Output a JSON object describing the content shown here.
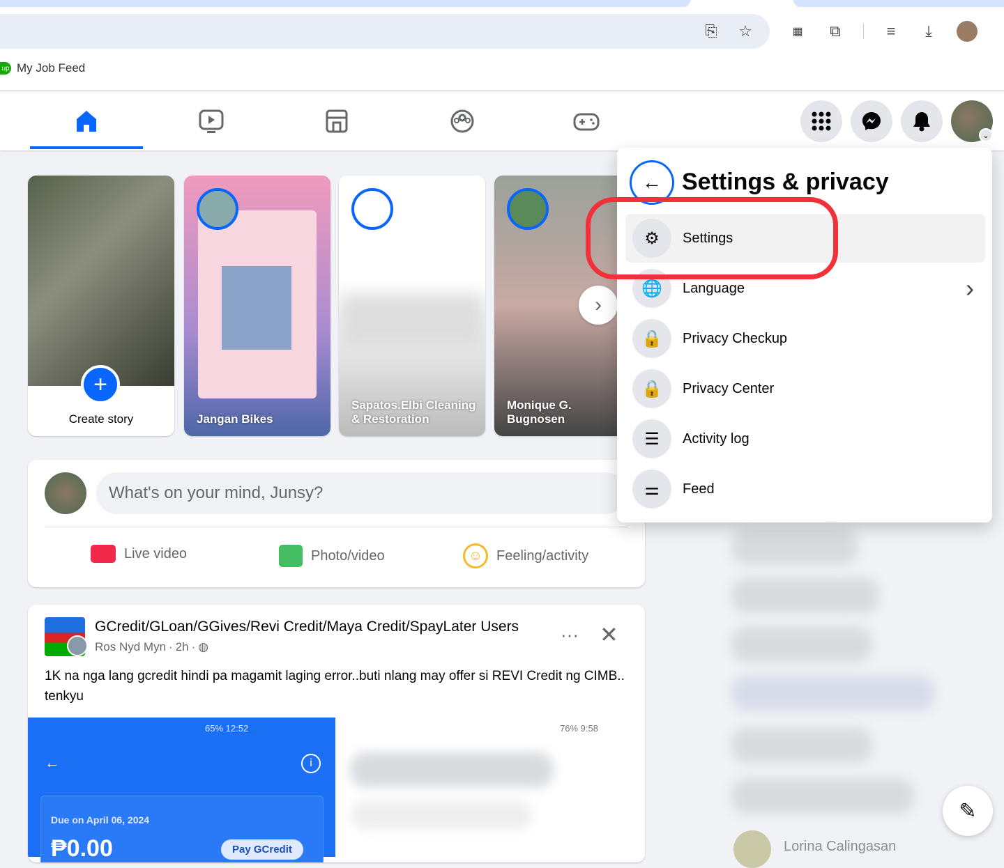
{
  "browser": {
    "bookmark": "My Job Feed",
    "toolbar_icons": [
      "install-app-icon",
      "star-icon",
      "qr-icon",
      "extensions-icon",
      "reading-list-icon",
      "download-icon",
      "profile-icon"
    ]
  },
  "nav": {
    "tabs": [
      "home",
      "watch",
      "marketplace",
      "groups",
      "gaming"
    ],
    "active": "home",
    "accent": "#0866ff"
  },
  "stories": [
    {
      "label": "Create story"
    },
    {
      "label": "Jangan Bikes"
    },
    {
      "label": "Sapatos.Elbi Cleaning & Restoration"
    },
    {
      "label": "Monique G. Bugnosen"
    }
  ],
  "composer": {
    "placeholder": "What's on your mind, Junsy?",
    "actions": [
      "Live video",
      "Photo/video",
      "Feeling/activity"
    ]
  },
  "post": {
    "group": "GCredit/GLoan/GGives/Revi Credit/Maya Credit/SpayLater Users",
    "author": "Ros Nyd Myn",
    "time": "2h",
    "sep": "·",
    "text": "1K na nga lang gcredit hindi pa magamit laging error..buti nlang may offer si REVI Credit ng CIMB.. tenkyu",
    "img1": {
      "status_left": "65%",
      "time": "12:52",
      "due": "Due on April 06, 2024",
      "amount": "₱0.00",
      "button": "Pay GCredit"
    },
    "img2": {
      "battery": "76%",
      "time": "9:58"
    }
  },
  "menu": {
    "title": "Settings & privacy",
    "items": [
      "Settings",
      "Language",
      "Privacy Checkup",
      "Privacy Center",
      "Activity log",
      "Feed"
    ]
  },
  "contacts": {
    "visible": "Lorina Calingasan"
  }
}
